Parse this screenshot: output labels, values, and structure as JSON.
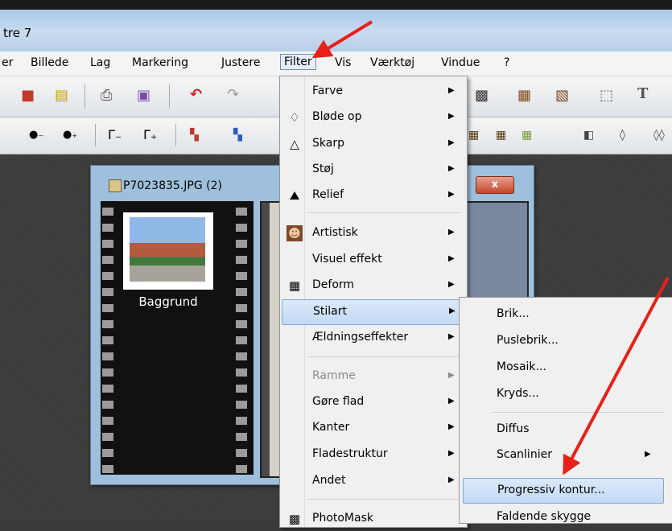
{
  "window_title": "tre 7",
  "menubar": {
    "items": [
      "er",
      "Billede",
      "Lag",
      "Markering",
      "Justere",
      "Filter",
      "Vis",
      "Værktøj",
      "Vindue",
      "?"
    ]
  },
  "toolbar_row1": [
    "save-icon",
    "properties-icon",
    "print-icon",
    "scan-icon",
    "undo-icon",
    "redo-icon",
    "filter-effect-icon",
    "frame-effect-icon",
    "crop-icon",
    "text-icon"
  ],
  "toolbar_row2": [
    "darken-icon",
    "lighten-icon",
    "gamma-minus-icon",
    "gamma-plus-icon",
    "color-minus-icon",
    "color-plus-icon",
    "mosaic-icon",
    "pattern-icon",
    "grid-icon",
    "half-icon",
    "drop-icon",
    "drops-icon"
  ],
  "image_window": {
    "title": "P7023835.JPG (2)",
    "close_glyph": "x",
    "layer_label": "Baggrund"
  },
  "filter_menu": {
    "items": [
      {
        "label": "Farve",
        "submenu": true
      },
      {
        "label": "Bløde op",
        "submenu": true,
        "icon": "drop-icon"
      },
      {
        "label": "Skarp",
        "submenu": true,
        "icon": "triangle-icon"
      },
      {
        "label": "Støj",
        "submenu": true
      },
      {
        "label": "Relief",
        "submenu": true,
        "icon": "relief-icon"
      },
      {
        "label": "Artistisk",
        "submenu": true,
        "icon": "portrait-icon"
      },
      {
        "label": "Visuel effekt",
        "submenu": true
      },
      {
        "label": "Deform",
        "submenu": true,
        "icon": "grid-deform-icon"
      },
      {
        "label": "Stilart",
        "submenu": true,
        "highlighted": true
      },
      {
        "label": "Ældningseffekter",
        "submenu": true
      },
      {
        "label": "Ramme",
        "submenu": true,
        "disabled": true
      },
      {
        "label": "Gøre flad",
        "submenu": true
      },
      {
        "label": "Kanter",
        "submenu": true
      },
      {
        "label": "Fladestruktur",
        "submenu": true
      },
      {
        "label": "Andet",
        "submenu": true
      },
      {
        "label": "PhotoMask",
        "submenu": false,
        "icon": "photomask-icon"
      }
    ]
  },
  "stilart_submenu": {
    "items": [
      {
        "label": "Brik..."
      },
      {
        "label": "Puslebrik..."
      },
      {
        "label": "Mosaik..."
      },
      {
        "label": "Kryds..."
      },
      {
        "label": "Diffus"
      },
      {
        "label": "Scanlinier",
        "submenu": true
      },
      {
        "label": "Progressiv kontur...",
        "highlighted": true
      },
      {
        "label": "Faldende skygge"
      }
    ]
  },
  "annotation_color": "#e8201a"
}
